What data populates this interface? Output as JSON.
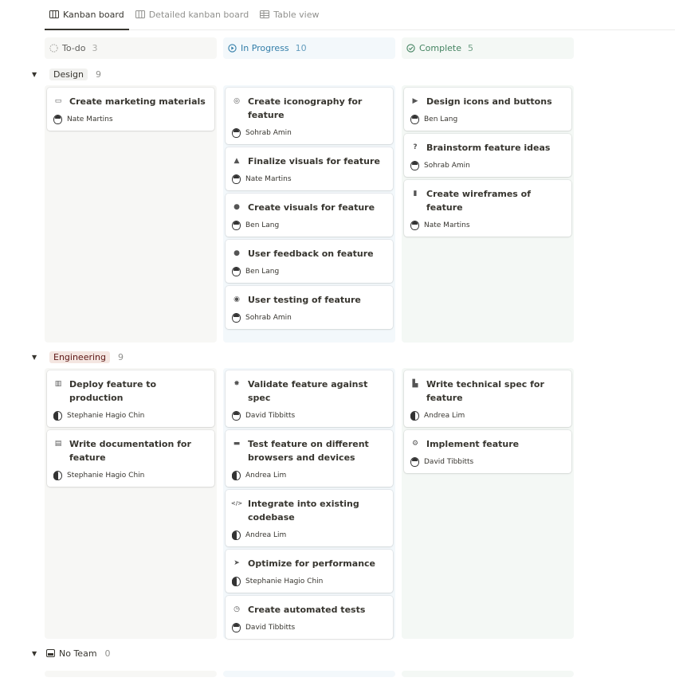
{
  "tabs": [
    {
      "label": "Kanban board",
      "icon": "board-icon",
      "active": true
    },
    {
      "label": "Detailed kanban board",
      "icon": "board-icon",
      "active": false
    },
    {
      "label": "Table view",
      "icon": "table-icon",
      "active": false
    }
  ],
  "columns": [
    {
      "label": "To-do",
      "count": "3",
      "icon": "dashed-circle-icon",
      "color": "#5f5e5b"
    },
    {
      "label": "In Progress",
      "count": "10",
      "icon": "play-circle-icon",
      "color": "#337ea9"
    },
    {
      "label": "Complete",
      "count": "5",
      "icon": "check-circle-icon",
      "color": "#448361"
    }
  ],
  "groups": [
    {
      "label": "Design",
      "count": "9",
      "todo": [
        {
          "title": "Create marketing materials",
          "icon": "browser-icon",
          "person": "Nate Martins"
        }
      ],
      "inprog": [
        {
          "title": "Create iconography for feature",
          "icon": "target-icon",
          "person": "Sohrab Amin"
        },
        {
          "title": "Finalize visuals for feature",
          "icon": "brush-icon",
          "person": "Nate Martins"
        },
        {
          "title": "Create visuals for feature",
          "icon": "palette-icon",
          "person": "Ben Lang"
        },
        {
          "title": "User feedback on feature",
          "icon": "chat-bubble-icon",
          "person": "Ben Lang"
        },
        {
          "title": "User testing of feature",
          "icon": "user-circle-icon",
          "person": "Sohrab Amin"
        }
      ],
      "complete": [
        {
          "title": "Design icons and buttons",
          "icon": "play-icon",
          "person": "Ben Lang"
        },
        {
          "title": "Brainstorm feature ideas",
          "icon": "question-head-icon",
          "person": "Sohrab Amin"
        },
        {
          "title": "Create wireframes of feature",
          "icon": "phone-icon",
          "person": "Nate Martins"
        }
      ]
    },
    {
      "label": "Engineering",
      "count": "9",
      "todo": [
        {
          "title": "Deploy feature to production",
          "icon": "factory-icon",
          "person": "Stephanie Hagio Chin"
        },
        {
          "title": "Write documentation for feature",
          "icon": "keyboard-icon",
          "person": "Stephanie Hagio Chin"
        }
      ],
      "inprog": [
        {
          "title": "Validate feature against spec",
          "icon": "badge-icon",
          "person": "David Tibbitts"
        },
        {
          "title": "Test feature on different browsers and devices",
          "icon": "laptop-icon",
          "person": "Andrea Lim"
        },
        {
          "title": "Integrate into existing codebase",
          "icon": "code-icon",
          "person": "Andrea Lim"
        },
        {
          "title": "Optimize for performance",
          "icon": "rabbit-icon",
          "person": "Stephanie Hagio Chin"
        },
        {
          "title": "Create automated tests",
          "icon": "clock-icon",
          "person": "David Tibbitts"
        }
      ],
      "complete": [
        {
          "title": "Write technical spec for feature",
          "icon": "document-icon",
          "person": "Andrea Lim"
        },
        {
          "title": "Implement feature",
          "icon": "gear-icon",
          "person": "David Tibbitts"
        }
      ]
    },
    {
      "label": "No Team",
      "count": "0",
      "icon": "inbox-icon",
      "todo": [],
      "inprog": [],
      "complete": []
    }
  ],
  "icon_glyphs": {
    "browser-icon": "▭",
    "target-icon": "◎",
    "brush-icon": "▲",
    "palette-icon": "●",
    "chat-bubble-icon": "●",
    "user-circle-icon": "◉",
    "play-icon": "▶",
    "question-head-icon": "?",
    "phone-icon": "▮",
    "factory-icon": "▥",
    "keyboard-icon": "▤",
    "badge-icon": "✸",
    "laptop-icon": "▬",
    "code-icon": "</>",
    "rabbit-icon": "➤",
    "clock-icon": "◷",
    "document-icon": "▙",
    "gear-icon": "⚙"
  }
}
